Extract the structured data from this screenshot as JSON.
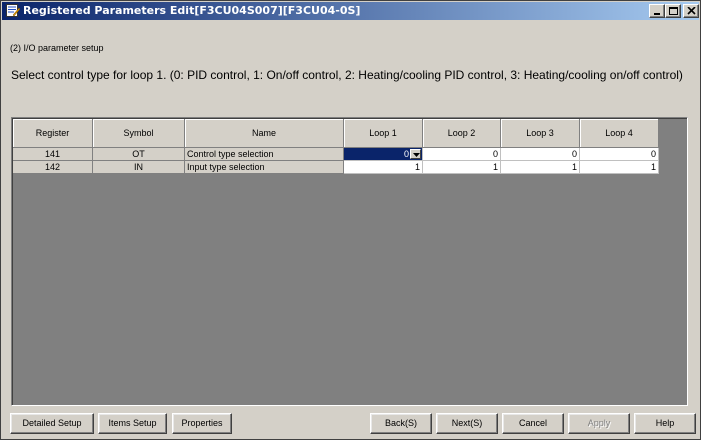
{
  "window": {
    "title": "Registered Parameters Edit[F3CU04S007][F3CU04-0S]"
  },
  "breadcrumb": "(2) I/O parameter setup",
  "instruction": "Select control type for loop 1. (0: PID control, 1: On/off control, 2: Heating/cooling PID control, 3: Heating/cooling on/off control)",
  "grid": {
    "headers": [
      "Register",
      "Symbol",
      "Name",
      "Loop 1",
      "Loop 2",
      "Loop 3",
      "Loop 4"
    ],
    "rows": [
      {
        "register": "141",
        "symbol": "OT",
        "name": "Control type selection",
        "loops": [
          "0",
          "0",
          "0",
          "0"
        ]
      },
      {
        "register": "142",
        "symbol": "IN",
        "name": "Input type selection",
        "loops": [
          "1",
          "1",
          "1",
          "1"
        ]
      }
    ],
    "selected_cell": "row 1, Loop 1"
  },
  "buttons": {
    "detailed_setup": "Detailed Setup",
    "items_setup": "Items Setup",
    "properties": "Properties",
    "back": "Back(S)",
    "next": "Next(S)",
    "cancel": "Cancel",
    "apply": "Apply",
    "help": "Help"
  },
  "colors": {
    "titlebar": "#0a246a",
    "selection": "#0a246a",
    "window_face": "#d4d0c8",
    "grid_background": "#808080"
  },
  "icons": [
    "app-edit-icon",
    "minimize-icon",
    "maximize-icon",
    "close-icon",
    "dropdown-arrow-icon"
  ]
}
